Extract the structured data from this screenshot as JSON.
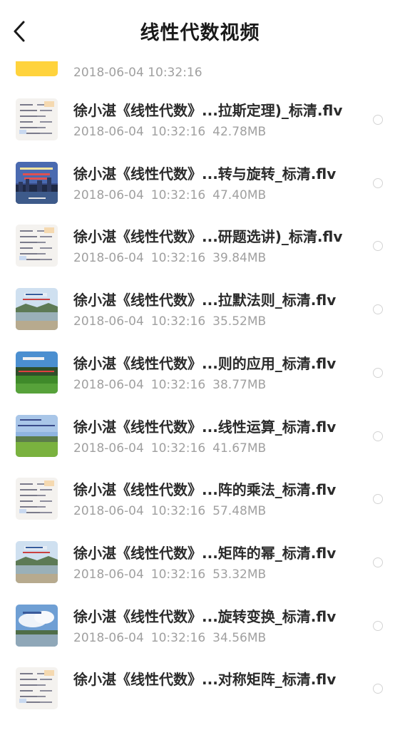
{
  "header": {
    "title": "线性代数视频",
    "back_icon": "back-arrow-icon"
  },
  "partial_item": {
    "meta": "2018-06-04  10:32:16",
    "thumb_color": "#ffd33d"
  },
  "items": [
    {
      "name": "徐小湛《线性代数》...拉斯定理)_标清.flv",
      "date": "2018-06-04",
      "time": "10:32:16",
      "size": "42.78MB",
      "thumb": "doc"
    },
    {
      "name": "徐小湛《线性代数》...转与旋转_标清.flv",
      "date": "2018-06-04",
      "time": "10:32:16",
      "size": "47.40MB",
      "thumb": "city"
    },
    {
      "name": "徐小湛《线性代数》...研题选讲)_标清.flv",
      "date": "2018-06-04",
      "time": "10:32:16",
      "size": "39.84MB",
      "thumb": "doc"
    },
    {
      "name": "徐小湛《线性代数》...拉默法则_标清.flv",
      "date": "2018-06-04",
      "time": "10:32:16",
      "size": "35.52MB",
      "thumb": "lake"
    },
    {
      "name": "徐小湛《线性代数》...则的应用_标清.flv",
      "date": "2018-06-04",
      "time": "10:32:16",
      "size": "38.77MB",
      "thumb": "field"
    },
    {
      "name": "徐小湛《线性代数》...线性运算_标清.flv",
      "date": "2018-06-04",
      "time": "10:32:16",
      "size": "41.67MB",
      "thumb": "meadow"
    },
    {
      "name": "徐小湛《线性代数》...阵的乘法_标清.flv",
      "date": "2018-06-04",
      "time": "10:32:16",
      "size": "57.48MB",
      "thumb": "doc"
    },
    {
      "name": "徐小湛《线性代数》...矩阵的幂_标清.flv",
      "date": "2018-06-04",
      "time": "10:32:16",
      "size": "53.32MB",
      "thumb": "lake"
    },
    {
      "name": "徐小湛《线性代数》...旋转变换_标清.flv",
      "date": "2018-06-04",
      "time": "10:32:16",
      "size": "34.56MB",
      "thumb": "cloud"
    },
    {
      "name": "徐小湛《线性代数》...对称矩阵_标清.flv",
      "date": "",
      "time": "",
      "size": "",
      "thumb": "doc"
    }
  ],
  "colors": {
    "title": "#1a1a1a",
    "name": "#2b2b2b",
    "meta": "#a0a0a0",
    "radio": "#d3d3d3",
    "accent": "#ffd33d"
  }
}
